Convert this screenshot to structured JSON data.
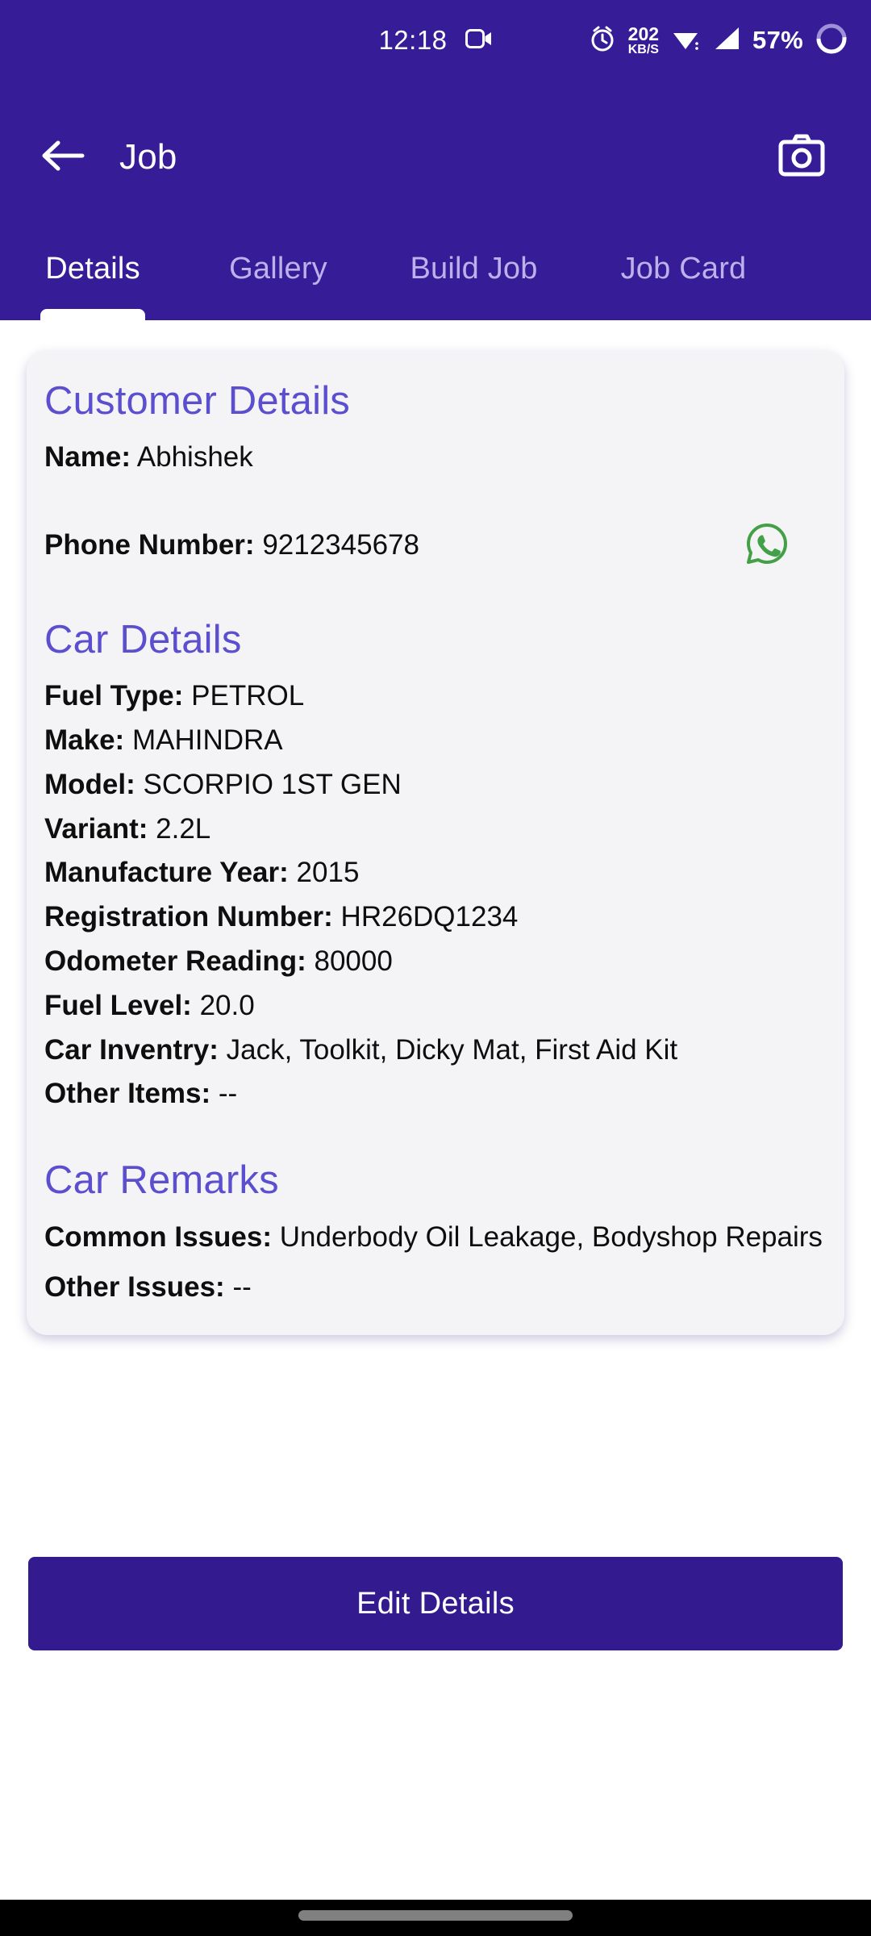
{
  "status_bar": {
    "time": "12:18",
    "screen_record_icon": "video-camera-icon",
    "alarm_icon": "alarm-clock-icon",
    "network_speed_value": "202",
    "network_speed_unit": "KB/S",
    "wifi_icon": "wifi-icon",
    "signal_icon": "cellular-signal-icon",
    "battery_percent": "57%",
    "battery_icon": "battery-circle-icon"
  },
  "app_bar": {
    "back_icon": "arrow-left-icon",
    "title": "Job",
    "camera_icon": "camera-icon"
  },
  "tabs": {
    "active_index": 0,
    "items": [
      {
        "label": "Details"
      },
      {
        "label": "Gallery"
      },
      {
        "label": "Build Job"
      },
      {
        "label": "Job Card"
      }
    ]
  },
  "card": {
    "customer_details": {
      "heading": "Customer Details",
      "fields": [
        {
          "label": "Name:",
          "value": "Abhishek"
        },
        {
          "label": "Phone Number:",
          "value": "9212345678"
        }
      ],
      "whatsapp_icon": "whatsapp-icon"
    },
    "car_details": {
      "heading": "Car Details",
      "fields": [
        {
          "label": "Fuel Type:",
          "value": "PETROL"
        },
        {
          "label": "Make:",
          "value": "MAHINDRA"
        },
        {
          "label": "Model:",
          "value": "SCORPIO 1ST GEN"
        },
        {
          "label": "Variant:",
          "value": "2.2L"
        },
        {
          "label": "Manufacture Year:",
          "value": "2015"
        },
        {
          "label": "Registration Number:",
          "value": "HR26DQ1234"
        },
        {
          "label": "Odometer Reading:",
          "value": "80000"
        },
        {
          "label": "Fuel Level:",
          "value": "20.0"
        },
        {
          "label": "Car Inventry:",
          "value": "Jack, Toolkit, Dicky Mat, First Aid Kit"
        },
        {
          "label": "Other Items:",
          "value": "--"
        }
      ]
    },
    "car_remarks": {
      "heading": "Car Remarks",
      "fields": [
        {
          "label": "Common Issues:",
          "value": "Underbody Oil Leakage, Bodyshop Repairs"
        },
        {
          "label": "Other Issues:",
          "value": "--"
        }
      ]
    }
  },
  "edit_button": {
    "label": "Edit Details"
  },
  "colors": {
    "header_purple": "#361c97",
    "button_purple": "#331a8e",
    "heading_purple": "#5b4fd0",
    "tab_inactive": "#bcb1ea",
    "card_bg": "#f4f4f6",
    "whatsapp_green": "#43a047"
  }
}
